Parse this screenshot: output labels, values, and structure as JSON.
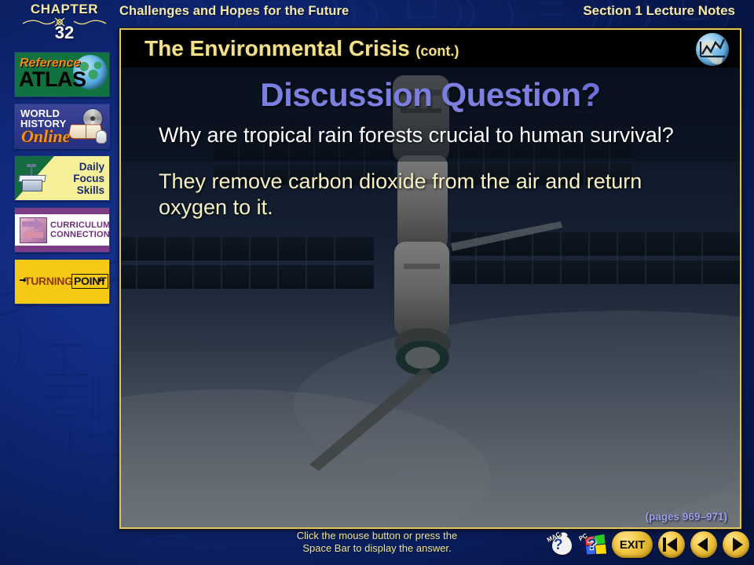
{
  "header": {
    "chapter_word": "CHAPTER",
    "chapter_number": "32",
    "title": "Challenges and Hopes for the Future",
    "section": "Section 1 Lecture Notes"
  },
  "sidebar": {
    "items": [
      {
        "name": "reference-atlas",
        "line1": "Reference",
        "line2": "ATLAS",
        "icon": "globe-icon"
      },
      {
        "name": "world-history-online",
        "line1": "WORLD",
        "line2": "HISTORY",
        "line3": "Online",
        "icon": "book-cd-icon"
      },
      {
        "name": "daily-focus-skills",
        "line1": "Daily",
        "line2": "Focus",
        "line3": "Skills",
        "icon": "desk-icon"
      },
      {
        "name": "curriculum-connection",
        "line1": "CURRICULUM",
        "line2": "CONNECTION",
        "icon": "arrows-icon"
      },
      {
        "name": "turning-point",
        "line1": "TURNING",
        "line2": "POINT",
        "icon": "arrow-icon"
      }
    ]
  },
  "content": {
    "slide_title": "The Environmental Crisis",
    "slide_title_cont": "(cont.)",
    "globe_icon": "globe-chart-icon",
    "discussion_heading": "Discussion Question",
    "discussion_heading_mark": "?",
    "question": "Why are tropical rain forests crucial to human survival?",
    "answer": "They remove carbon dioxide from the air and return oxygen to it.",
    "pages_reference": "(pages 969–971)",
    "photo_caption": "space-station-orbiting-earth"
  },
  "footer": {
    "instruction_line1": "Click the mouse button or press the",
    "instruction_line2": "Space Bar to display the answer.",
    "buttons": [
      {
        "name": "mac-help-button",
        "label": "MAC",
        "badge": "?"
      },
      {
        "name": "pc-help-button",
        "label": "PC",
        "badge": "?"
      },
      {
        "name": "exit-button",
        "label": "EXIT"
      },
      {
        "name": "first-slide-button",
        "label": ""
      },
      {
        "name": "previous-slide-button",
        "label": ""
      },
      {
        "name": "next-slide-button",
        "label": ""
      }
    ]
  },
  "colors": {
    "background_blue": "#122c80",
    "gold": "#f3e08a",
    "frame_border": "#e2c25a",
    "discussion_purple": "#7b7fe0",
    "answer_cream": "#f6f0c2",
    "pages_purple": "#9aa0ef"
  }
}
